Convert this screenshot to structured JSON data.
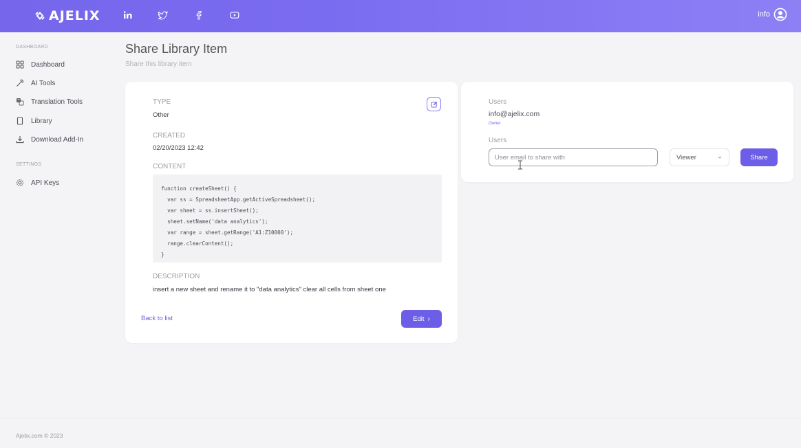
{
  "header": {
    "logo_text": "AJELIX",
    "social_icons": [
      "linkedin-icon",
      "twitter-icon",
      "facebook-icon",
      "youtube-icon"
    ],
    "user_name": "info"
  },
  "sidebar": {
    "sections": [
      {
        "title": "DASHBOARD"
      },
      {
        "title": "SETTINGS"
      }
    ],
    "items": [
      {
        "label": "Dashboard",
        "icon": "grid-icon"
      },
      {
        "label": "AI Tools",
        "icon": "wrench-icon"
      },
      {
        "label": "Translation Tools",
        "icon": "translate-icon"
      },
      {
        "label": "Library",
        "icon": "bookmark-icon"
      },
      {
        "label": "Download Add-In",
        "icon": "download-icon"
      },
      {
        "label": "API Keys",
        "icon": "gear-icon"
      }
    ]
  },
  "page": {
    "title": "Share Library Item",
    "subtitle": "Share this library item"
  },
  "item": {
    "type_label": "TYPE",
    "type_value": "Other",
    "created_label": "CREATED",
    "created_value": "02/20/2023 12:42",
    "content_label": "CONTENT",
    "code_lines": [
      "function createSheet() {",
      "  var ss = SpreadsheetApp.getActiveSpreadsheet();",
      "  var sheet = ss.insertSheet();",
      "  sheet.setName('data analytics');",
      "  var range = sheet.getRange('A1:Z10000');",
      "  range.clearContent();",
      "}"
    ],
    "description_label": "DESCRIPTION",
    "description_value": "insert a new sheet and rename it to \"data analytics\" clear all cells from sheet one",
    "back_label": "Back to list",
    "edit_label": "Edit"
  },
  "share": {
    "users_label": "Users",
    "owner_email": "info@ajelix.com",
    "owner_role": "Owner",
    "users_label_2": "Users",
    "email_placeholder": "User email to share with",
    "role_value": "Viewer",
    "share_label": "Share"
  },
  "footer": {
    "text": "Ajelix.com © 2023"
  },
  "colors": {
    "accent": "#6d5ee8",
    "header_start": "#7566ec",
    "header_end": "#8d80f5"
  }
}
